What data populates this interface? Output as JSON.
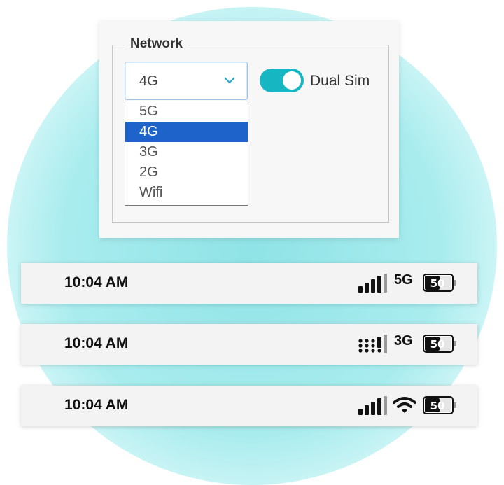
{
  "network_panel": {
    "legend": "Network",
    "select_value": "4G",
    "options": [
      "5G",
      "4G",
      "3G",
      "2G",
      "Wifi"
    ],
    "selected_index": 1,
    "dual_sim_label": "Dual Sim",
    "dual_sim_on": true
  },
  "status_bars": [
    {
      "time": "10:04 AM",
      "network": "5G",
      "signal": "full",
      "battery": "50"
    },
    {
      "time": "10:04 AM",
      "network": "3G",
      "signal": "dotted",
      "battery": "50"
    },
    {
      "time": "10:04 AM",
      "network": "",
      "connection_icon": "wifi-icon",
      "signal": "full",
      "battery": "50"
    }
  ],
  "colors": {
    "accent": "#16b6c2",
    "selection": "#1e63c9",
    "glow": "#8fe3e6"
  }
}
